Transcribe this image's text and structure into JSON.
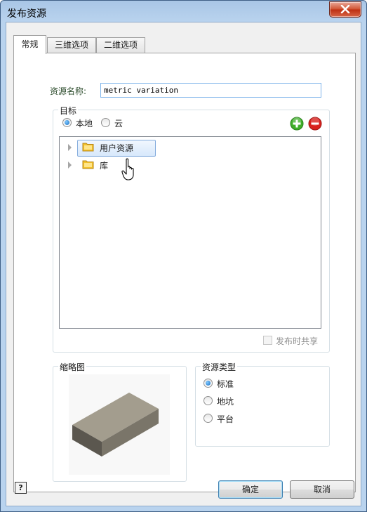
{
  "window": {
    "title": "发布资源"
  },
  "tabs": [
    {
      "label": "常规",
      "active": true
    },
    {
      "label": "三维选项",
      "active": false
    },
    {
      "label": "二维选项",
      "active": false
    }
  ],
  "resource_name": {
    "label": "资源名称:",
    "value": "metric variation"
  },
  "target": {
    "group_label": "目标",
    "options": [
      {
        "label": "本地",
        "checked": true
      },
      {
        "label": "云",
        "checked": false
      }
    ],
    "tree": [
      {
        "label": "用户资源",
        "selected": true
      },
      {
        "label": "库",
        "selected": false
      }
    ],
    "share_checkbox": {
      "label": "发布时共享",
      "checked": false,
      "enabled": false
    }
  },
  "thumbnail": {
    "group_label": "缩略图"
  },
  "resource_type": {
    "group_label": "资源类型",
    "options": [
      {
        "label": "标准",
        "checked": true
      },
      {
        "label": "地坑",
        "checked": false
      },
      {
        "label": "平台",
        "checked": false
      }
    ]
  },
  "buttons": {
    "ok": "确定",
    "cancel": "取消",
    "help": "?"
  },
  "colors": {
    "add": "#3fae2a",
    "remove": "#d9211d",
    "folder": "#f3c12b",
    "accent": "#1b6fc2"
  }
}
